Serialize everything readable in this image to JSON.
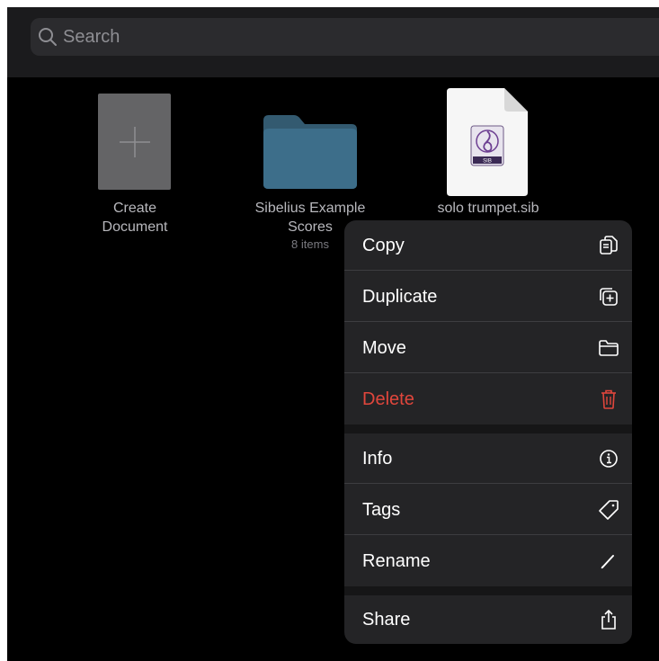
{
  "search": {
    "placeholder": "Search"
  },
  "grid": {
    "create": {
      "label_line1": "Create",
      "label_line2": "Document"
    },
    "folder": {
      "label_line1": "Sibelius Example",
      "label_line2": "Scores",
      "count": "8 items"
    },
    "file": {
      "label": "solo trumpet.sib",
      "badge": "SIB"
    }
  },
  "menu": {
    "copy": "Copy",
    "duplicate": "Duplicate",
    "move": "Move",
    "delete": "Delete",
    "info": "Info",
    "tags": "Tags",
    "rename": "Rename",
    "share": "Share"
  },
  "colors": {
    "background": "#000000",
    "menu_bg": "#242426",
    "destructive": "#e0463c",
    "folder": "#3d6e8a"
  }
}
